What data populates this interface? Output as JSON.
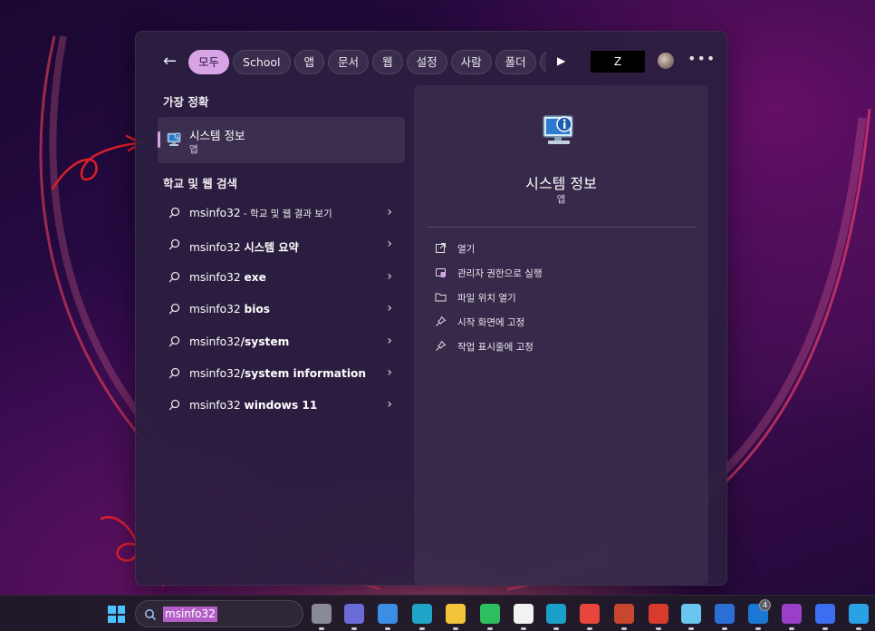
{
  "filters": {
    "chips": [
      "모두",
      "School",
      "앱",
      "문서",
      "웹",
      "설정",
      "사람",
      "폴더",
      "사"
    ],
    "active_index": 0,
    "account_label": "Z"
  },
  "best_match": {
    "header": "가장 정확",
    "name": "시스템 정보",
    "kind": "앱"
  },
  "web_search": {
    "header": "학교 및 웹 검색",
    "items": [
      {
        "prefix": "msinfo32",
        "bold": "",
        "small": " - 학교 및 웹 결과 보기"
      },
      {
        "prefix": "msinfo32 ",
        "bold": "시스템 요약",
        "small": ""
      },
      {
        "prefix": "msinfo32 ",
        "bold": "exe",
        "small": ""
      },
      {
        "prefix": "msinfo32 ",
        "bold": "bios",
        "small": ""
      },
      {
        "prefix": "msinfo32",
        "bold": "/system",
        "small": ""
      },
      {
        "prefix": "msinfo32",
        "bold": "/system information",
        "small": ""
      },
      {
        "prefix": "msinfo32 ",
        "bold": "windows 11",
        "small": ""
      }
    ]
  },
  "detail": {
    "title": "시스템 정보",
    "subtitle": "앱",
    "actions": [
      {
        "icon": "open-external-icon",
        "label": "열기"
      },
      {
        "icon": "admin-shield-icon",
        "label": "관리자 권한으로 실행"
      },
      {
        "icon": "folder-icon",
        "label": "파일 위치 열기"
      },
      {
        "icon": "pin-icon",
        "label": "시작 화면에 고정"
      },
      {
        "icon": "pin-icon",
        "label": "작업 표시줄에 고정"
      }
    ]
  },
  "taskbar": {
    "search_query": "msinfo32",
    "badge_count": "4",
    "apps": [
      {
        "name": "task-view-icon",
        "color": "#8a8a96"
      },
      {
        "name": "chat-icon",
        "color": "#6b6bd8"
      },
      {
        "name": "store-icon",
        "color": "#3a8ee6"
      },
      {
        "name": "edge-icon",
        "color": "#1fa4c8"
      },
      {
        "name": "file-explorer-icon",
        "color": "#f2c43a"
      },
      {
        "name": "evernote-icon",
        "color": "#2dbe60"
      },
      {
        "name": "notion-icon",
        "color": "#f2f2f2"
      },
      {
        "name": "bird-app-icon",
        "color": "#1aa0c8"
      },
      {
        "name": "chrome-icon",
        "color": "#e8453c"
      },
      {
        "name": "stripes-app-icon",
        "color": "#c8462e"
      },
      {
        "name": "recorder-icon",
        "color": "#d83a2e"
      },
      {
        "name": "notepad-icon",
        "color": "#6ac6f0"
      },
      {
        "name": "word-icon",
        "color": "#2b6fd6"
      },
      {
        "name": "outlook-icon",
        "color": "#1a78d4"
      },
      {
        "name": "onenote-icon",
        "color": "#9a3fc8"
      },
      {
        "name": "todo-icon",
        "color": "#3b6ef0"
      },
      {
        "name": "bing-icon",
        "color": "#2aa0e6"
      }
    ]
  },
  "colors": {
    "accent": "#d9a4e6",
    "panel": "#2c1e40",
    "search_highlight": "#b45fc8"
  }
}
